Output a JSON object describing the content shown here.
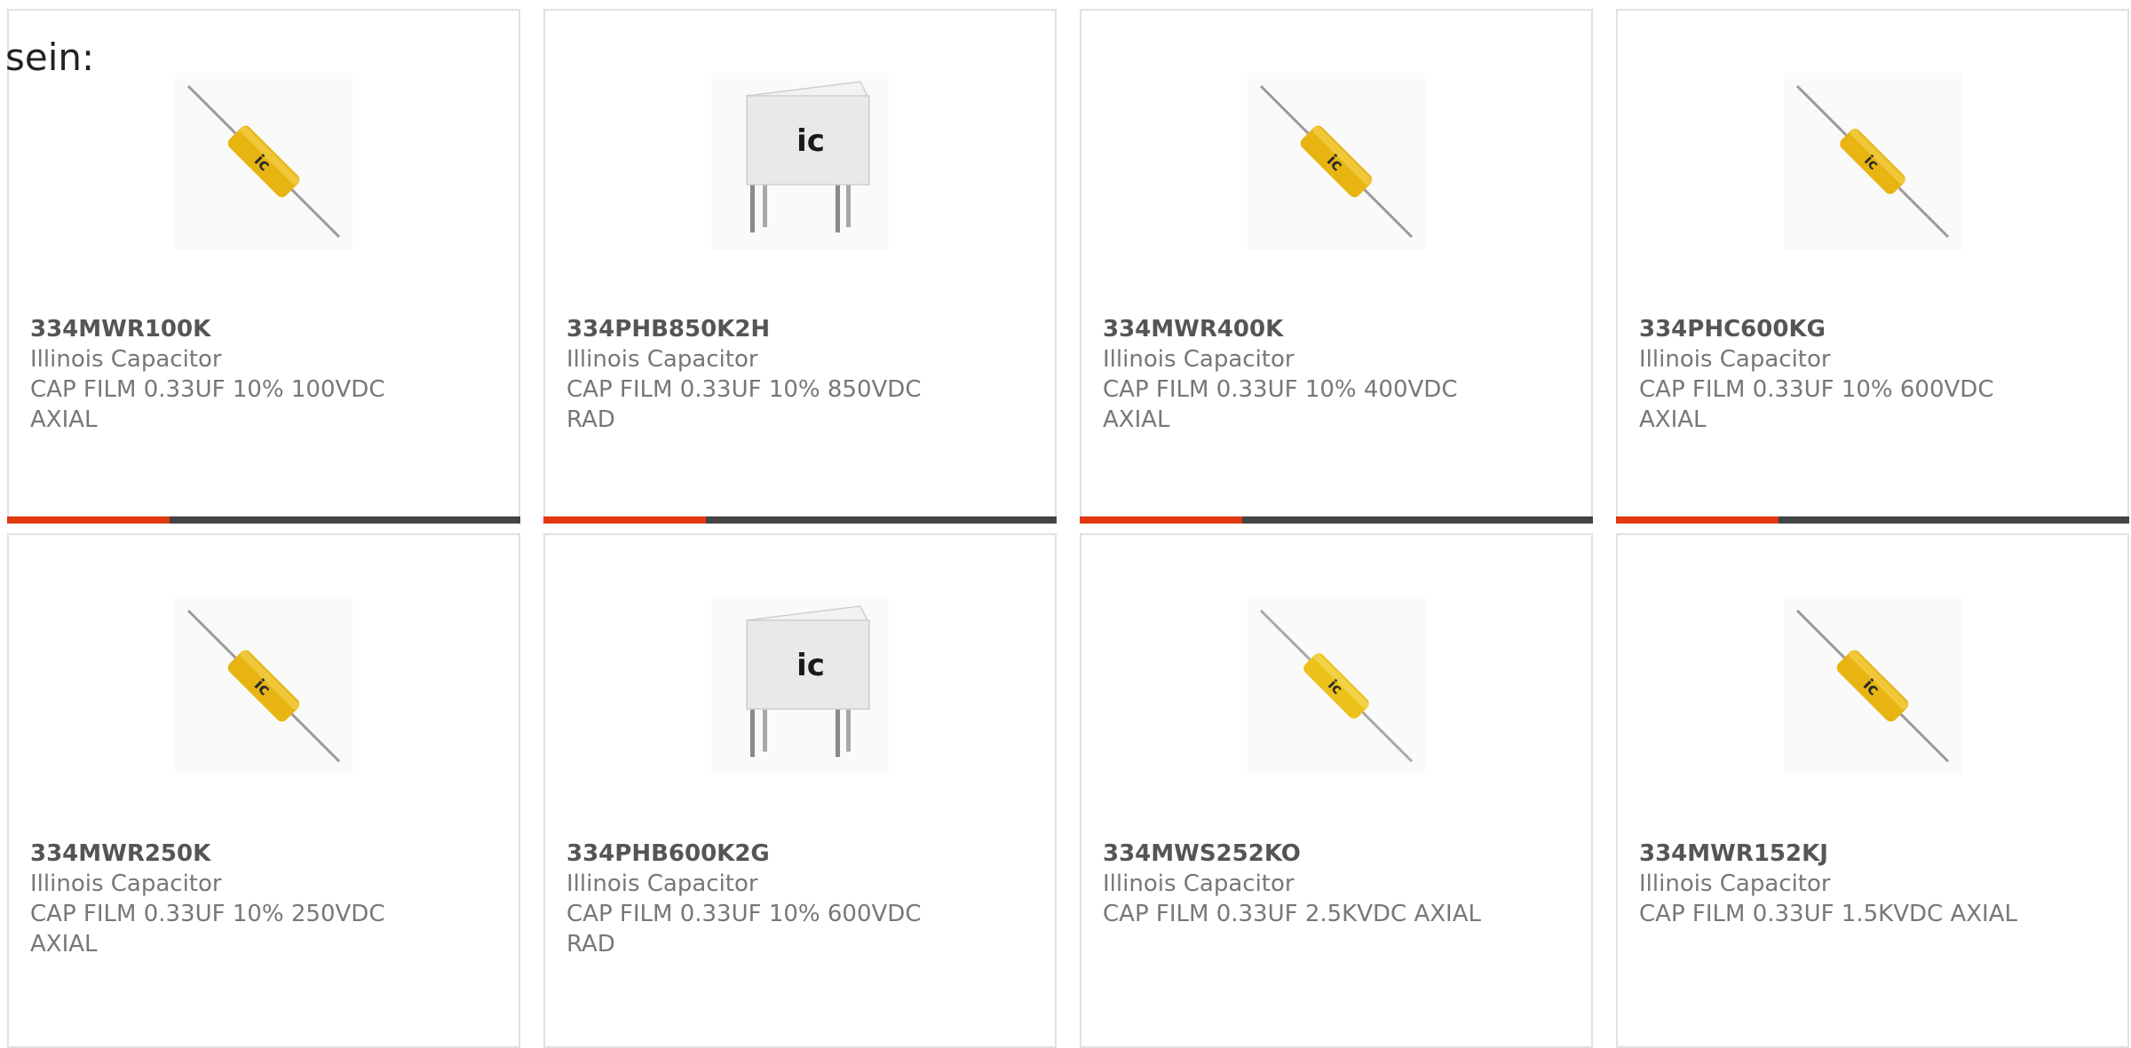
{
  "heading": "sein:",
  "colors": {
    "accent": "#e03a12",
    "bar": "#444444",
    "border": "#e1e1e1"
  },
  "products": [
    {
      "part": "334MWR100K",
      "brand": "Illinois Capacitor",
      "desc": "CAP FILM 0.33UF 10% 100VDC",
      "desc2": "AXIAL",
      "image": "axial-capacitor"
    },
    {
      "part": "334PHB850K2H",
      "brand": "Illinois Capacitor",
      "desc": "CAP FILM 0.33UF 10% 850VDC",
      "desc2": "RAD",
      "image": "radial-capacitor"
    },
    {
      "part": "334MWR400K",
      "brand": "Illinois Capacitor",
      "desc": "CAP FILM 0.33UF 10% 400VDC",
      "desc2": "AXIAL",
      "image": "axial-capacitor"
    },
    {
      "part": "334PHC600KG",
      "brand": "Illinois Capacitor",
      "desc": "CAP FILM 0.33UF 10% 600VDC",
      "desc2": "AXIAL",
      "image": "axial-capacitor"
    },
    {
      "part": "334MWR250K",
      "brand": "Illinois Capacitor",
      "desc": "CAP FILM 0.33UF 10% 250VDC",
      "desc2": "AXIAL",
      "image": "axial-capacitor"
    },
    {
      "part": "334PHB600K2G",
      "brand": "Illinois Capacitor",
      "desc": "CAP FILM 0.33UF 10% 600VDC",
      "desc2": "RAD",
      "image": "radial-capacitor"
    },
    {
      "part": "334MWS252KO",
      "brand": "Illinois Capacitor",
      "desc": "CAP FILM 0.33UF 2.5KVDC AXIAL",
      "desc2": "",
      "image": "axial-capacitor"
    },
    {
      "part": "334MWR152KJ",
      "brand": "Illinois Capacitor",
      "desc": "CAP FILM 0.33UF 1.5KVDC AXIAL",
      "desc2": "",
      "image": "axial-capacitor"
    }
  ]
}
